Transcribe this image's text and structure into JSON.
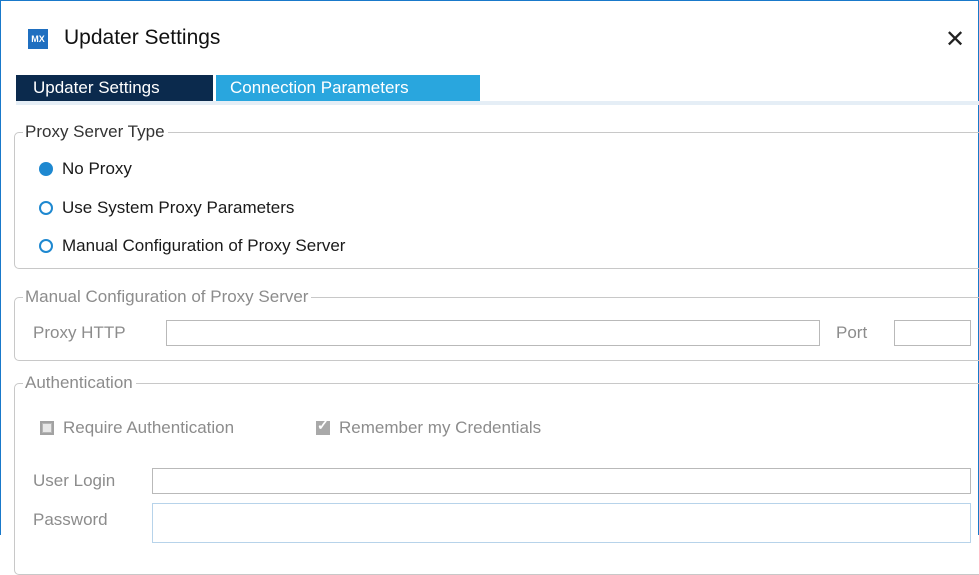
{
  "window": {
    "title": "Updater Settings",
    "app_icon_text": "MX",
    "close_glyph": "✕"
  },
  "tabs": [
    {
      "label": "Updater Settings",
      "active": true
    },
    {
      "label": "Connection Parameters",
      "active": false
    }
  ],
  "proxy_type": {
    "legend": "Proxy Server Type",
    "options": [
      {
        "label": "No Proxy",
        "checked": true
      },
      {
        "label": "Use System Proxy Parameters",
        "checked": false
      },
      {
        "label": "Manual Configuration of Proxy Server",
        "checked": false
      }
    ]
  },
  "manual_config": {
    "legend": "Manual Configuration of Proxy Server",
    "proxy_http_label": "Proxy HTTP",
    "proxy_http_value": "",
    "port_label": "Port",
    "port_value": ""
  },
  "authentication": {
    "legend": "Authentication",
    "require_auth_label": "Require Authentication",
    "require_auth_checked": false,
    "remember_label": "Remember my Credentials",
    "remember_checked": true,
    "user_login_label": "User Login",
    "user_login_value": "",
    "password_label": "Password",
    "password_value": ""
  },
  "colors": {
    "accent": "#1e88d0",
    "tab_active_bg": "#0b2a4d",
    "tab_inactive_bg": "#29a6de",
    "disabled_text": "#8c8c8c"
  }
}
